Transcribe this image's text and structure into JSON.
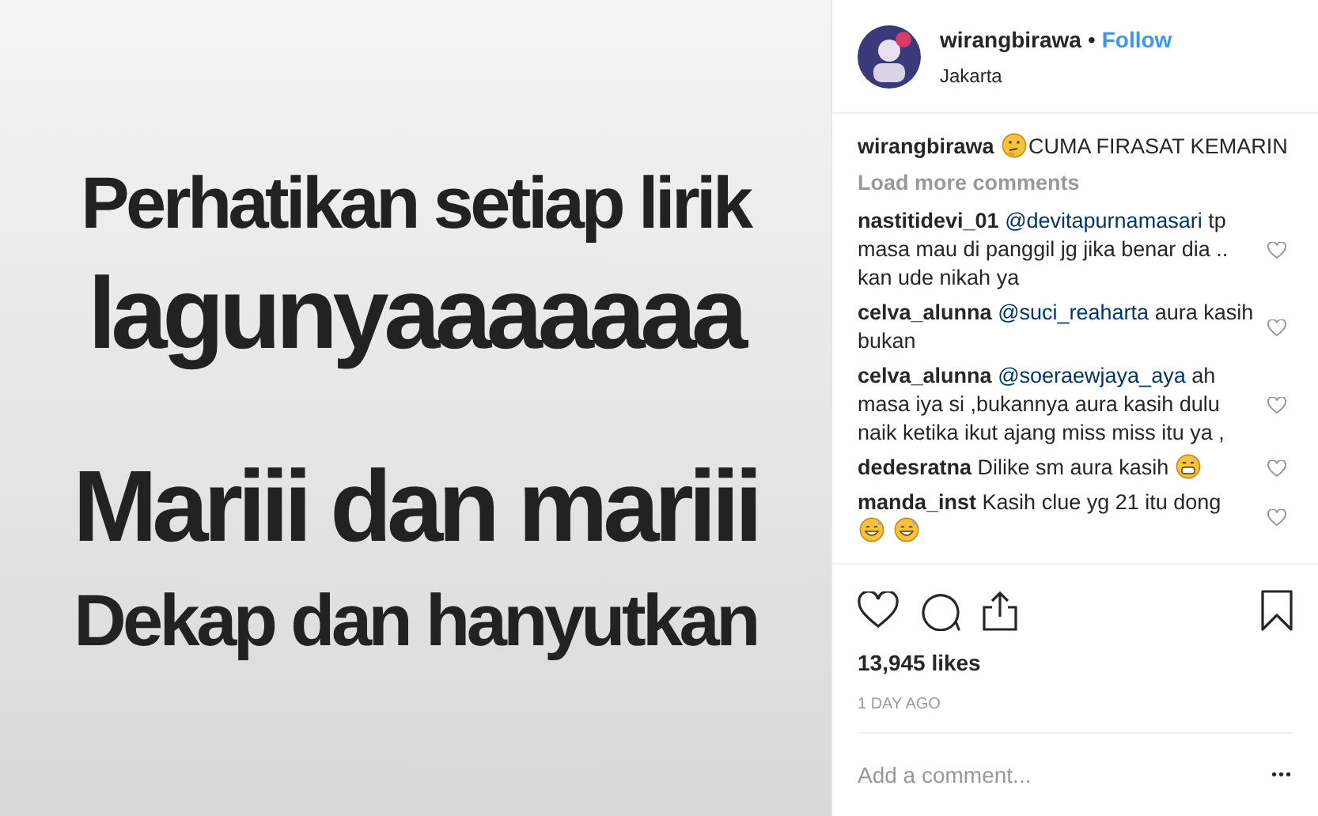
{
  "post_image": {
    "lines": [
      "Perhatikan setiap lirik",
      "lagunyaaaaaaa",
      "Mariii dan mariii",
      "Dekap dan hanyutkan"
    ]
  },
  "header": {
    "username": "wirangbirawa",
    "separator": "•",
    "follow": "Follow",
    "location": "Jakarta"
  },
  "caption": {
    "user": "wirangbirawa",
    "emojis": [
      {
        "kind": "thinking"
      }
    ],
    "text": "CUMA FIRASAT KEMARIN"
  },
  "load_more": "Load more comments",
  "comments": [
    {
      "user": "nastitidevi_01",
      "mention": "@devitapurnamasari",
      "text": "tp masa mau di panggil jg jika benar dia .. kan ude nikah ya"
    },
    {
      "user": "celva_alunna",
      "mention": "@suci_reaharta",
      "text": "aura kasih bukan"
    },
    {
      "user": "celva_alunna",
      "mention": "@soeraewjaya_aya",
      "text": "ah masa iya si ,bukannya aura kasih dulu naik ketika ikut ajang miss miss itu ya ,"
    },
    {
      "user": "dedesratna",
      "text": "Dilike sm aura kasih",
      "emojis": [
        {
          "kind": "grin"
        }
      ]
    },
    {
      "user": "manda_inst",
      "text": "Kasih clue yg 21 itu dong",
      "emojis": [
        {
          "kind": "sweat_smile"
        },
        {
          "kind": "sweat_smile"
        }
      ]
    }
  ],
  "likes": "13,945 likes",
  "time": "1 DAY AGO",
  "comment_field": {
    "placeholder": "Add a comment..."
  },
  "more": "•••"
}
